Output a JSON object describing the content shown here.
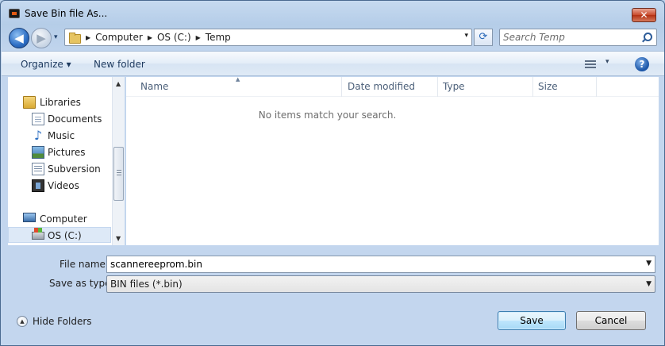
{
  "window": {
    "title": "Save Bin file As...",
    "close_glyph": "✕"
  },
  "nav": {
    "back_glyph": "◀",
    "forward_glyph": "▶",
    "recent_glyph": "▾"
  },
  "address": {
    "crumbs": [
      "Computer",
      "OS (C:)",
      "Temp"
    ],
    "sep_glyph": "▶",
    "dropdown_glyph": "▾",
    "refresh_glyph": "⟳"
  },
  "search": {
    "placeholder": "Search Temp"
  },
  "toolbar": {
    "organize": "Organize ▾",
    "new_folder": "New folder",
    "view_dd": "▾",
    "help": "?"
  },
  "sidebar": {
    "items": [
      {
        "label": "Libraries",
        "icon": "libraries-icon"
      },
      {
        "label": "Documents",
        "icon": "documents-icon"
      },
      {
        "label": "Music",
        "icon": "music-icon"
      },
      {
        "label": "Pictures",
        "icon": "pictures-icon"
      },
      {
        "label": "Subversion",
        "icon": "subversion-icon"
      },
      {
        "label": "Videos",
        "icon": "videos-icon"
      },
      {
        "label": "Computer",
        "icon": "computer-icon"
      },
      {
        "label": "OS (C:)",
        "icon": "drive-icon"
      }
    ],
    "music_glyph": "♪",
    "scroll_up": "▲",
    "scroll_down": "▼"
  },
  "filelist": {
    "columns": [
      "Name",
      "Date modified",
      "Type",
      "Size"
    ],
    "sort_glyph": "▲",
    "empty_message": "No items match your search."
  },
  "form": {
    "file_name_label": "File name:",
    "file_name_value": "scannereeprom.bin",
    "save_type_label": "Save as type:",
    "save_type_value": "BIN files (*.bin)",
    "dropdown_glyph": "▼"
  },
  "footer": {
    "hide_folders": "Hide Folders",
    "hide_glyph": "▲",
    "save": "Save",
    "cancel": "Cancel"
  },
  "colors": {
    "accent": "#2d6ec4",
    "chrome": "#c6daf0",
    "close": "#c94a2c"
  }
}
